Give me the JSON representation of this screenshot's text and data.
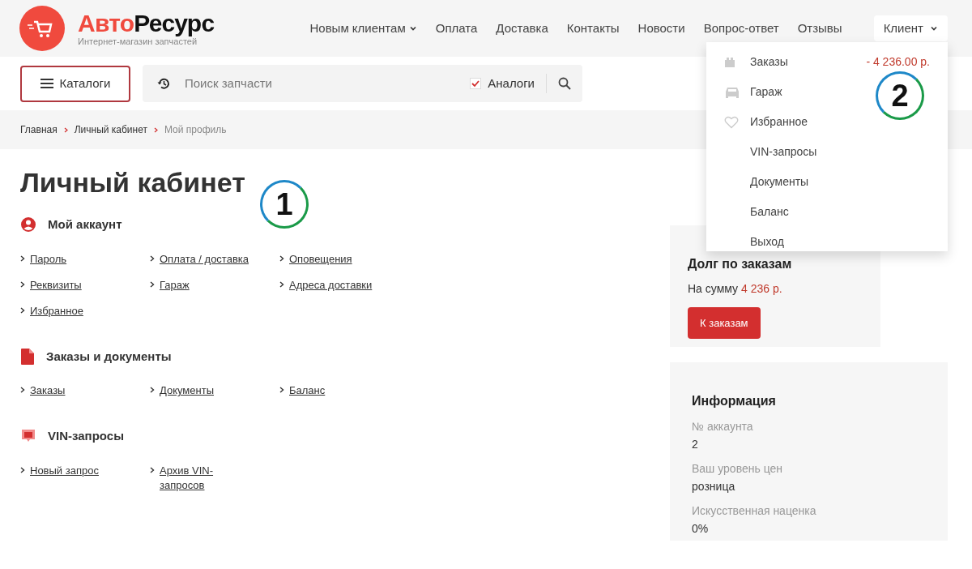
{
  "header": {
    "logo": {
      "first": "Авто",
      "second": "Ресурс",
      "tagline": "Интернет-магазин запчастей"
    },
    "nav": [
      {
        "label": "Новым клиентам",
        "dropdown": true
      },
      {
        "label": "Оплата",
        "dropdown": false
      },
      {
        "label": "Доставка",
        "dropdown": false
      },
      {
        "label": "Контакты",
        "dropdown": false
      },
      {
        "label": "Новости",
        "dropdown": false
      },
      {
        "label": "Вопрос-ответ",
        "dropdown": false
      },
      {
        "label": "Отзывы",
        "dropdown": false
      }
    ],
    "client_button": {
      "label": "Клиент"
    }
  },
  "toolbar": {
    "catalog_button": "Каталоги",
    "search": {
      "placeholder": "Поиск запчасти"
    },
    "analogs": {
      "label": "Аналоги",
      "checked": true
    }
  },
  "breadcrumbs": [
    {
      "label": "Главная",
      "current": false
    },
    {
      "label": "Личный кабинет",
      "current": false
    },
    {
      "label": "Мой профиль",
      "current": true
    }
  ],
  "page_title": "Личный кабинет",
  "sections": [
    {
      "title": "Мой аккаунт",
      "kind": "account",
      "links": [
        "Пароль",
        "Оплата / доставка",
        "Оповещения",
        "Реквизиты",
        "Гараж",
        "Адреса доставки",
        "Избранное"
      ]
    },
    {
      "title": "Заказы и документы",
      "kind": "document",
      "links": [
        "Заказы",
        "Документы",
        "Баланс"
      ]
    },
    {
      "title": "VIN-запросы",
      "kind": "chat",
      "links": [
        "Новый запрос",
        "Архив VIN-запросов"
      ]
    }
  ],
  "client_menu": [
    {
      "label": "Заказы",
      "kind": "gift",
      "amount": "- 4 236.00 р."
    },
    {
      "label": "Гараж",
      "kind": "car"
    },
    {
      "label": "Избранное",
      "kind": "heart"
    },
    {
      "label": "VIN-запросы",
      "kind": "plain"
    },
    {
      "label": "Документы",
      "kind": "plain"
    },
    {
      "label": "Баланс",
      "kind": "plain"
    },
    {
      "label": "Выход",
      "kind": "plain"
    }
  ],
  "debt_card": {
    "title": "Долг по заказам",
    "text": "На сумму",
    "amount": "4 236 р.",
    "button": "К заказам"
  },
  "info_card": {
    "title": "Информация",
    "fields": [
      {
        "label": "№ аккаунта",
        "value": "2"
      },
      {
        "label": "Ваш уровень цен",
        "value": "розница"
      },
      {
        "label": "Искусственная наценка",
        "value": "0%"
      }
    ]
  },
  "callouts": [
    "1",
    "2"
  ]
}
